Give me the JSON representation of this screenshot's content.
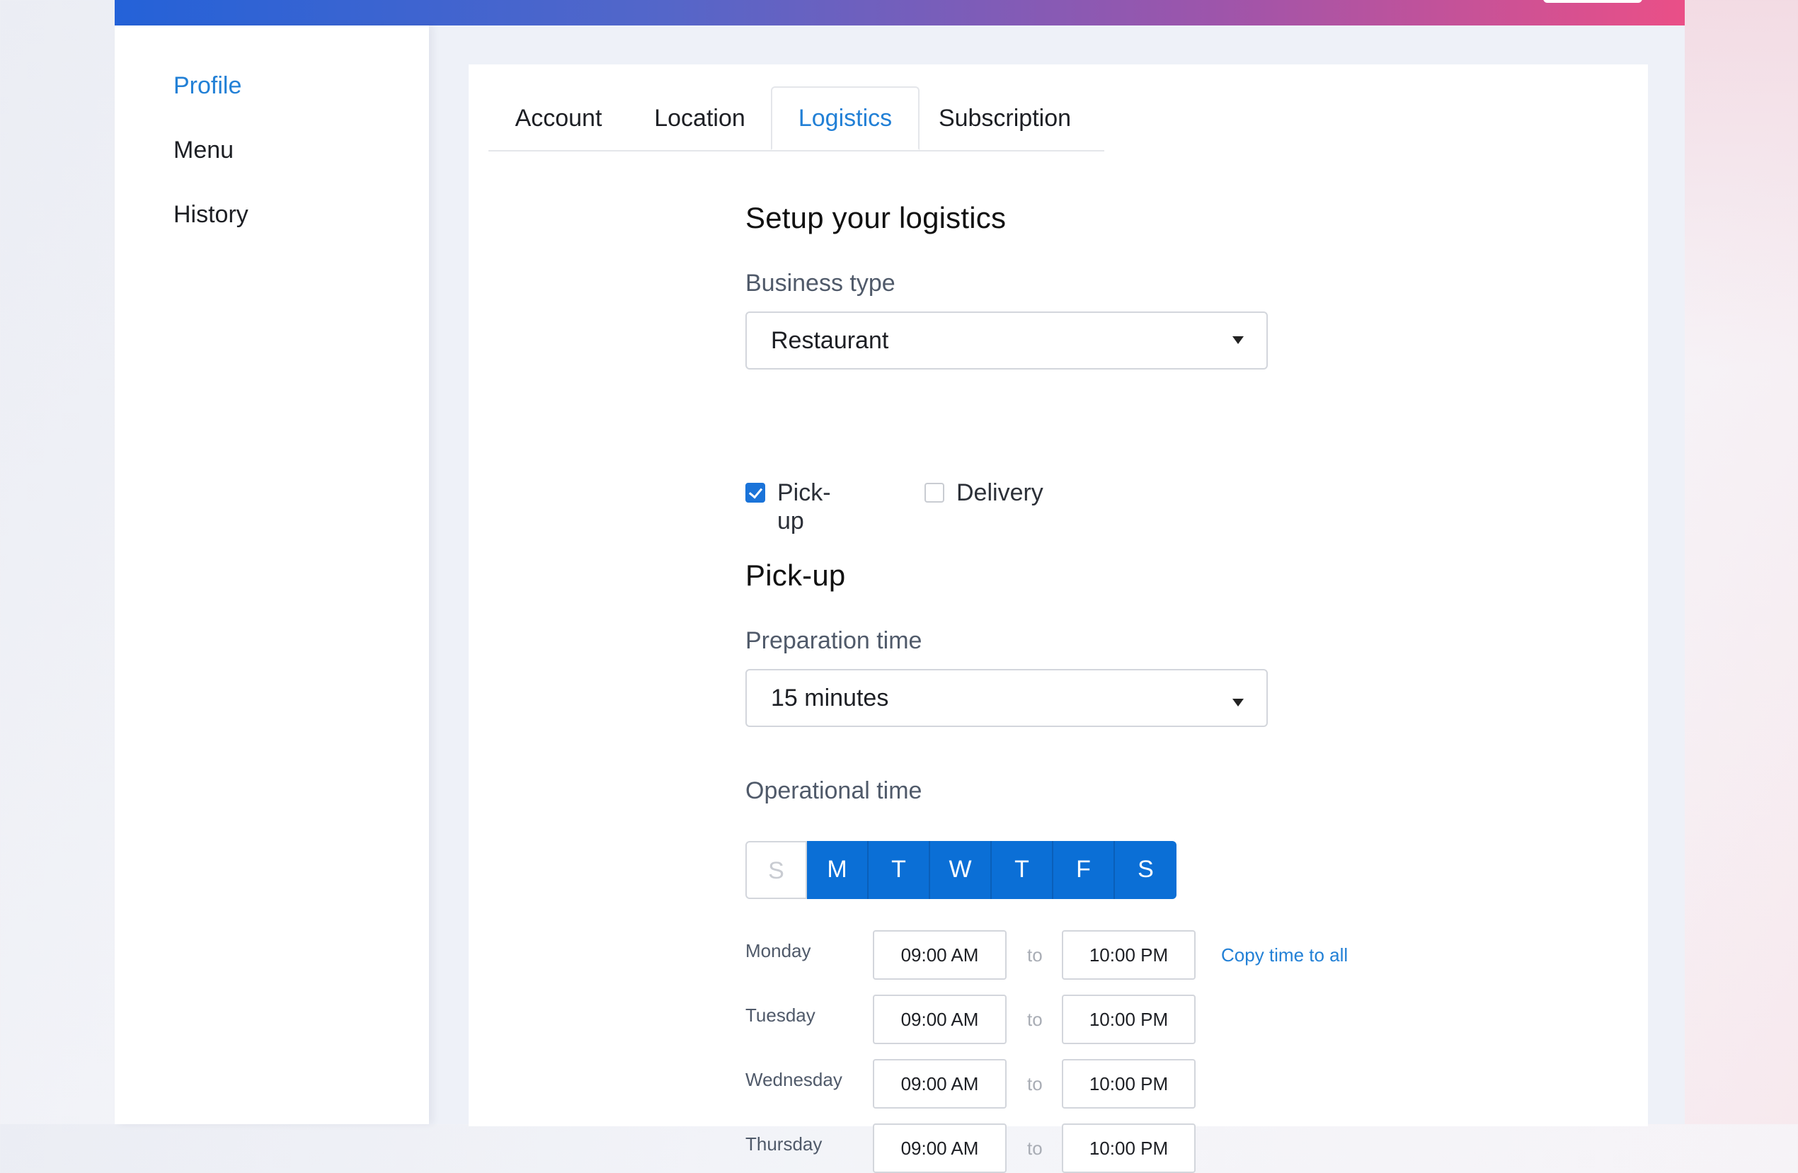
{
  "sidebar": {
    "items": [
      {
        "label": "Profile",
        "active": true
      },
      {
        "label": "Menu",
        "active": false
      },
      {
        "label": "History",
        "active": false
      }
    ]
  },
  "tabs": [
    {
      "label": "Account",
      "active": false
    },
    {
      "label": "Location",
      "active": false
    },
    {
      "label": "Logistics",
      "active": true
    },
    {
      "label": "Subscription",
      "active": false
    }
  ],
  "form": {
    "title": "Setup your logistics",
    "business_type_label": "Business type",
    "business_type_value": "Restaurant",
    "options": {
      "pickup_label": "Pick-up",
      "pickup_checked": true,
      "delivery_label": "Delivery",
      "delivery_checked": false
    },
    "pickup_heading": "Pick-up",
    "prep_label": "Preparation time",
    "prep_value": "15 minutes",
    "operational_label": "Operational time",
    "days": [
      {
        "label": "S",
        "selected": false
      },
      {
        "label": "M",
        "selected": true
      },
      {
        "label": "T",
        "selected": true
      },
      {
        "label": "W",
        "selected": true
      },
      {
        "label": "T",
        "selected": true
      },
      {
        "label": "F",
        "selected": true
      },
      {
        "label": "S",
        "selected": true
      }
    ],
    "to_text": "to",
    "copy_link": "Copy time to all",
    "schedule": [
      {
        "day": "Monday",
        "from": "09:00 AM",
        "to": "10:00 PM"
      },
      {
        "day": "Tuesday",
        "from": "09:00 AM",
        "to": "10:00 PM"
      },
      {
        "day": "Wednesday",
        "from": "09:00 AM",
        "to": "10:00 PM"
      },
      {
        "day": "Thursday",
        "from": "09:00 AM",
        "to": "10:00 PM"
      }
    ]
  },
  "colors": {
    "accent": "#2280d6",
    "day_selected": "#0b6fd6",
    "checkbox_on": "#1a73d9"
  }
}
